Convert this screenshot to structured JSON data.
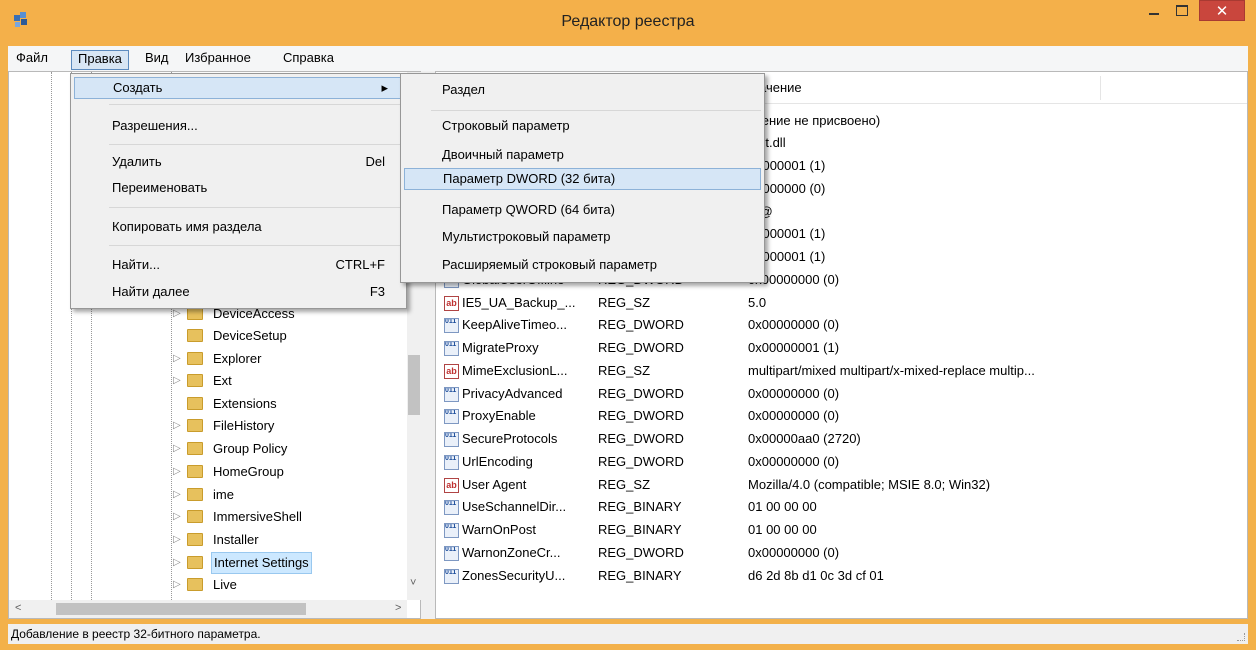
{
  "window": {
    "title": "Редактор реестра",
    "close_glyph": "✕",
    "accent_color": "#f4b04a",
    "close_color": "#c9463d"
  },
  "menubar": [
    "Файл",
    "Правка",
    "Вид",
    "Избранное",
    "Справка"
  ],
  "edit_menu": {
    "create": "Создать",
    "create_arrow": "▸",
    "permissions": "Разрешения...",
    "delete": "Удалить",
    "delete_shortcut": "Del",
    "rename": "Переименовать",
    "copy_key_name": "Копировать имя раздела",
    "find": "Найти...",
    "find_shortcut": "CTRL+F",
    "find_next": "Найти далее",
    "find_next_shortcut": "F3"
  },
  "create_menu": {
    "key": "Раздел",
    "string": "Строковый параметр",
    "binary": "Двоичный параметр",
    "dword": "Параметр DWORD (32 бита)",
    "qword": "Параметр QWORD (64 бита)",
    "multi_string": "Мультистроковый параметр",
    "expandable_string": "Расширяемый строковый параметр"
  },
  "tree": {
    "items": [
      {
        "label": "DeviceAccess",
        "expander": "▷"
      },
      {
        "label": "DeviceSetup",
        "expander": ""
      },
      {
        "label": "Explorer",
        "expander": "▷"
      },
      {
        "label": "Ext",
        "expander": "▷"
      },
      {
        "label": "Extensions",
        "expander": ""
      },
      {
        "label": "FileHistory",
        "expander": "▷"
      },
      {
        "label": "Group Policy",
        "expander": "▷"
      },
      {
        "label": "HomeGroup",
        "expander": "▷"
      },
      {
        "label": "ime",
        "expander": "▷"
      },
      {
        "label": "ImmersiveShell",
        "expander": "▷"
      },
      {
        "label": "Installer",
        "expander": "▷"
      },
      {
        "label": "Internet Settings",
        "expander": "▷"
      },
      {
        "label": "Live",
        "expander": "▷"
      }
    ],
    "scroll_down": "˅",
    "scroll_left": "<",
    "scroll_right": ">"
  },
  "list": {
    "value_header_fragment": "ачение",
    "rows": [
      {
        "name": "",
        "type": "",
        "value": "ачение не присвоено)",
        "icon": "none"
      },
      {
        "name": "",
        "type": "",
        "value": "inet.dll",
        "icon": "none"
      },
      {
        "name": "",
        "type": "",
        "value": "00000001 (1)",
        "icon": "none"
      },
      {
        "name": "",
        "type": "",
        "value": "00000000 (0)",
        "icon": "none"
      },
      {
        "name": "",
        "type": "",
        "value": "er@",
        "icon": "none"
      },
      {
        "name": "",
        "type": "",
        "value": "00000001 (1)",
        "icon": "none"
      },
      {
        "name": "",
        "type": "",
        "value": "00000001 (1)",
        "icon": "none"
      },
      {
        "name": "GlobalUserOffline",
        "type": "REG_DWORD",
        "value": "0x00000000 (0)",
        "icon": "bin"
      },
      {
        "name": "IE5_UA_Backup_...",
        "type": "REG_SZ",
        "value": "5.0",
        "icon": "sz"
      },
      {
        "name": "KeepAliveTimeo...",
        "type": "REG_DWORD",
        "value": "0x00000000 (0)",
        "icon": "bin"
      },
      {
        "name": "MigrateProxy",
        "type": "REG_DWORD",
        "value": "0x00000001 (1)",
        "icon": "bin"
      },
      {
        "name": "MimeExclusionL...",
        "type": "REG_SZ",
        "value": "multipart/mixed multipart/x-mixed-replace multip...",
        "icon": "sz"
      },
      {
        "name": "PrivacyAdvanced",
        "type": "REG_DWORD",
        "value": "0x00000000 (0)",
        "icon": "bin"
      },
      {
        "name": "ProxyEnable",
        "type": "REG_DWORD",
        "value": "0x00000000 (0)",
        "icon": "bin"
      },
      {
        "name": "SecureProtocols",
        "type": "REG_DWORD",
        "value": "0x00000aa0 (2720)",
        "icon": "bin"
      },
      {
        "name": "UrlEncoding",
        "type": "REG_DWORD",
        "value": "0x00000000 (0)",
        "icon": "bin"
      },
      {
        "name": "User Agent",
        "type": "REG_SZ",
        "value": "Mozilla/4.0 (compatible; MSIE 8.0; Win32)",
        "icon": "sz"
      },
      {
        "name": "UseSchannelDir...",
        "type": "REG_BINARY",
        "value": "01 00 00 00",
        "icon": "bin"
      },
      {
        "name": "WarnOnPost",
        "type": "REG_BINARY",
        "value": "01 00 00 00",
        "icon": "bin"
      },
      {
        "name": "WarnonZoneCr...",
        "type": "REG_DWORD",
        "value": "0x00000000 (0)",
        "icon": "bin"
      },
      {
        "name": "ZonesSecurityU...",
        "type": "REG_BINARY",
        "value": "d6 2d 8b d1 0c 3d cf 01",
        "icon": "bin"
      }
    ]
  },
  "icons": {
    "sz_text": "ab",
    "bin_text": "011 110"
  },
  "status_text": "Добавление в реестр 32-битного параметра."
}
